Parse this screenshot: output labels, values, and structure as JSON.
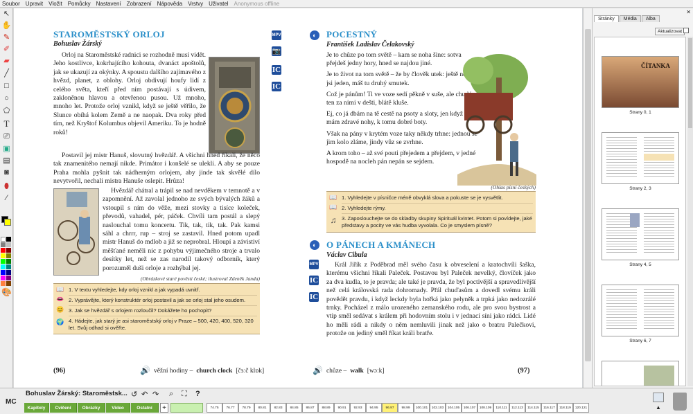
{
  "menu": [
    "Soubor",
    "Upravit",
    "Vložit",
    "Pomůcky",
    "Nastavení",
    "Zobrazení",
    "Nápověda",
    "Vrstvy",
    "Uživatel"
  ],
  "menu_status": "Anonymous offline",
  "colors": {
    "accent": "#2a8fc9",
    "task_bg": "#f6e2b5",
    "green": "#6aa839",
    "media_icon": "#1f4e9b",
    "highlight_page": "#fff176"
  },
  "toolbar_icons": [
    "pointer-icon",
    "hand-icon",
    "pen-icon",
    "marker-icon",
    "eraser-icon",
    "line-icon",
    "rectangle-icon",
    "ellipse-icon",
    "polygon-icon",
    "text-icon",
    "screenshot-icon",
    "image-icon",
    "frame-icon",
    "camera-icon",
    "fill-icon",
    "color-picker-icon",
    "palette-icon"
  ],
  "left_page": {
    "title": "STAROMĚSTSKÝ ORLOJ",
    "author": "Bohuslav Žárský",
    "p1": "Orloj na Staroměstské radnici se rozhodně musí vidět. Jeho kostlivce, kokrhajícího kohouta, dvanáct apoštolů, jak se ukazují za okýnky. A spoustu dalšího zajímavého z hvězd, planet, z oblohy. Orloj obdivují houfy lidí z celého světa, kteří před ním postávají s údivem, zakloněnou hlavou a otevřenou pusou. Už mnoho, mnoho let. Protože orloj vznikl, když se ještě věřilo, že Slunce obíhá kolem Země a ne naopak. Dva roky před tím, než Kryštof Kolumbus objevil Ameriku. To je hodně roků!",
    "p2": "Postavil jej mistr Hanuš, slovutný hvězdář. A všichni hned říkali, že něco tak znamenitého nemají nikde. Primátor i konšelé se ulekli. A aby se pouze Praha mohla pyšnit tak nádherným orlojem, aby jinde tak skvělé dílo nevytvořil, nechali mistra Hanuše oslepit. Hrůza!",
    "p3": "Hvězdář chátral a trápil se nad nevděkem v temnotě a v zapomnění. Až zavolal jednoho ze svých bývalých žáků a vstoupil s ním do věže, mezi stovky a tisíce koleček, převodů, vahadel, pér, páček. Chvíli tam postál a slepý naslouchal tomu koncertu. Tik, tak, tik, tak. Pak kamsi sáhl a chrrr, rup – stroj se zastavil. Hned potom upadl mistr Hanuš do mdlob a již se neprobral. Hloupí a závistiví měšťané neměli nic z pohybu výjimečného stroje a trvalo desítky let, než se zas narodil takový odborník, který porozuměl duši orloje a rozhýbal jej.",
    "caption": "(Obrázkové staré pověsti české; ilustroval Zdeněk Janda)",
    "tasks": [
      "1. V textu vyhledejte, kdy orloj vznikl a jak vypadá uvnitř.",
      "2. Vyprávějte, který konstruktér orloj postavil a jak se orloj stal jeho osudem.",
      "3. Jak se hvězdář s orlojem rozloučil? Dokážete ho pochopit?",
      "4. Hádejte, jak starý je asi staroměstský orloj v Praze – 500, 420, 400, 520, 320 let. Svůj odhad si ověřte."
    ],
    "media": [
      "MPV",
      "camera",
      "IC",
      "IC"
    ],
    "page_number": "(96)",
    "vocab": {
      "cz": "věžní hodiny –",
      "en": "church clock",
      "ipa": "[čɜːč klɒk]"
    }
  },
  "right_page": {
    "title": "POCESTNÝ",
    "author": "František Ladislav Čelakovský",
    "stanzas": [
      "Je to chůze po tom světě – kam se noha šine: sotva přejdeš jedny hory, hned se najdou jiné.",
      "Je to život na tom světě – že by člověk utek: ještě nezažil jsi jeden, máš tu druhý smutek.",
      "Což je pánům! Ti ve voze sedí pěkně v suše, ale chudý, ten za nimi v dešti, blátě kluše.",
      "Ej, co já dbám na tě cestě na psoty a sloty, jen když já mám zdravé nohy, k tomu dobré boty.",
      "Však na pány v krytém voze taky někdy trhne: jednou se jim kolo zláme, jindy vůz se zvrhne.",
      "A krom toho – až své pouti přejedem a přejdem, v jedné hospodě na nocleh pán nepán se sejdem."
    ],
    "caption": "(Ohlas písní českých)",
    "tasks": [
      "1. Vyhledejte v písničce méně obvyklá slova a pokuste se je vysvětlit.",
      "2. Vyhledejte rýmy.",
      "3. Zaposlouchejte se do skladby skupiny Spirituál kvintet. Potom si povídejte, jaké představy a pocity ve vás hudba vyvolala. Co je smyslem písně?"
    ],
    "title2": "O PÁNECH A KMÁNECH",
    "author2": "Václav Cibula",
    "p1": "Král Jiřík z Poděbrad měl svého času k obveselení a kratochvíli šaška, kterému všichni říkali Paleček. Postavou byl Paleček nevelký, človíček jako za dva kudla, to je pravda; ale také je pravda, že byl poctivější a spravedlivější než celá královská rada dohromady. Přál chuďasům a dovedl svému králi povědět pravdu, i když leckdy byla hořká jako pelyněk a trpká jako nedozrálé trnky. Pocházel z málo urozeného zemanského rodu, ale pro svou bystrost a vtip směl sedávat s králem při hodovním stolu i v jednací síni jako rádci. Lidé ho měli rádi a nikdy o něm nemluvili jinak než jako o bratru Palečkovi, protože on jediný směl říkat králi bratře.",
    "media": [
      "MPV",
      "IC",
      "IC"
    ],
    "page_number": "(97)",
    "vocab": {
      "cz": "chůze –",
      "en": "walk",
      "ipa": "[wɔːk]"
    }
  },
  "sidebar": {
    "tabs": [
      "Stránky",
      "Média",
      "Alba"
    ],
    "refresh": "Aktualizovat",
    "thumb_title": "ČÍTANKA",
    "thumbs": [
      "Strany 0, 1",
      "Strany 2, 3",
      "Strany 4, 5",
      "Strany 6, 7"
    ]
  },
  "bottom": {
    "mc": "MC",
    "doc_title": "Bohuslav Žárský: Staroměstsk...",
    "categories": [
      "Kapitoly",
      "Cvičení",
      "Obrázky",
      "Video",
      "Ostatní"
    ],
    "pages": [
      "74.75",
      "76.77",
      "78.79",
      "80.81",
      "82.83",
      "84.85",
      "86.87",
      "88.89",
      "90.91",
      "92.93",
      "94.95",
      "96.97",
      "98.99",
      "100.101",
      "102.103",
      "104.105",
      "106.107",
      "108.109",
      "110.111",
      "112.113",
      "114.115",
      "116.117",
      "118.119",
      "120.121"
    ],
    "current_page": "96.97"
  }
}
